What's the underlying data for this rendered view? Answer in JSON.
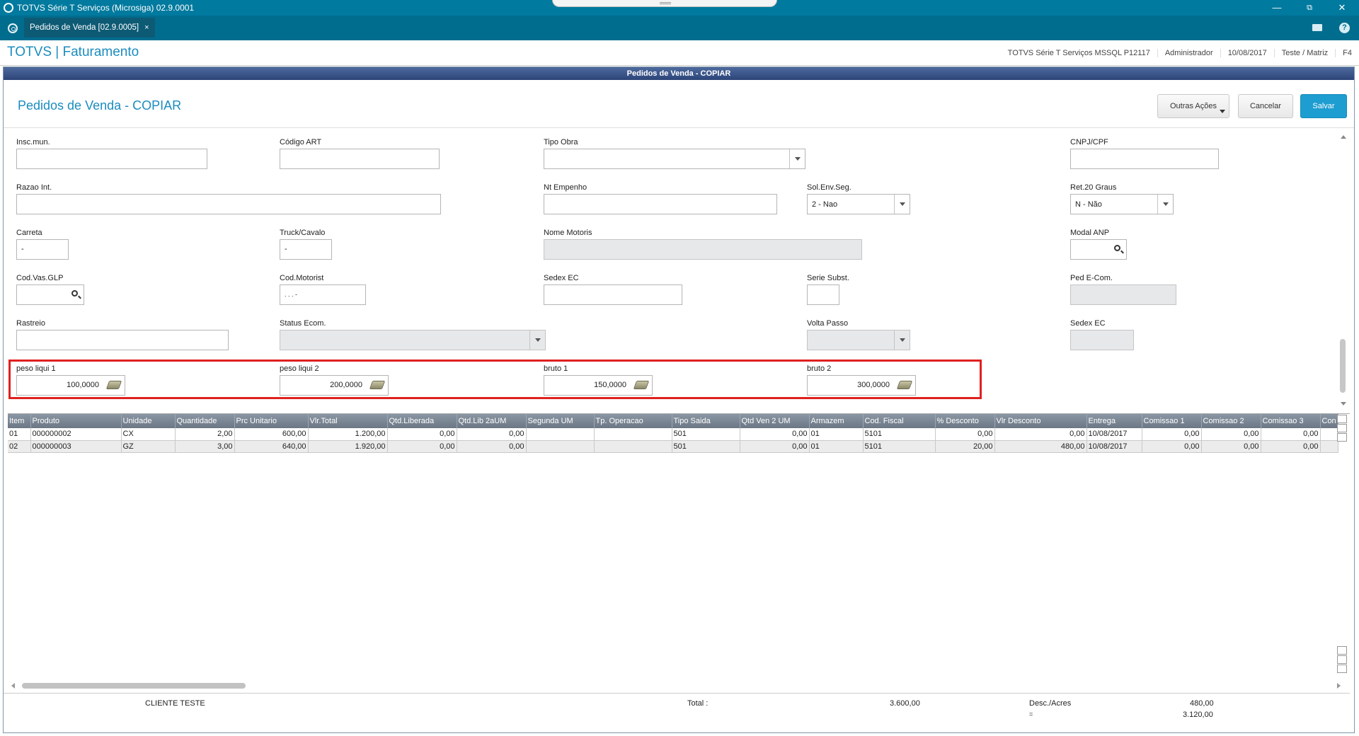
{
  "window": {
    "title": "TOTVS Série T Serviços (Microsiga) 02.9.0001"
  },
  "tab": {
    "label": "Pedidos de Venda [02.9.0005]",
    "close": "×"
  },
  "header": {
    "brand": "TOTVS | Faturamento",
    "env": "TOTVS Série T Serviços MSSQL P12117",
    "user": "Administrador",
    "date": "10/08/2017",
    "branch": "Teste / Matriz",
    "shortcut": "F4"
  },
  "frame": {
    "title": "Pedidos de Venda - COPIAR"
  },
  "page": {
    "title": "Pedidos de Venda - COPIAR",
    "btn_outras": "Outras Ações",
    "btn_cancelar": "Cancelar",
    "btn_salvar": "Salvar"
  },
  "fields": {
    "insc_mun": {
      "label": "Insc.mun.",
      "value": ""
    },
    "codigo_art": {
      "label": "Código ART",
      "value": ""
    },
    "tipo_obra": {
      "label": "Tipo Obra",
      "value": ""
    },
    "cnpj_cpf": {
      "label": "CNPJ/CPF",
      "value": ""
    },
    "razao_int": {
      "label": "Razao Int.",
      "value": ""
    },
    "nt_empenho": {
      "label": "Nt Empenho",
      "value": ""
    },
    "sol_env_seg": {
      "label": "Sol.Env.Seg.",
      "value": "2 - Nao"
    },
    "ret_20_graus": {
      "label": "Ret.20 Graus",
      "value": "N - Não"
    },
    "carreta": {
      "label": "Carreta",
      "value": "-"
    },
    "truck_cavalo": {
      "label": "Truck/Cavalo",
      "value": "-"
    },
    "nome_motoris": {
      "label": "Nome Motoris",
      "value": ""
    },
    "modal_anp": {
      "label": "Modal ANP",
      "value": ""
    },
    "cod_vas_glp": {
      "label": "Cod.Vas.GLP",
      "value": ""
    },
    "cod_motorist": {
      "label": "Cod.Motorist",
      "value": ". . . -"
    },
    "sedex_ec_1": {
      "label": "Sedex EC",
      "value": ""
    },
    "serie_subst": {
      "label": "Serie Subst.",
      "value": ""
    },
    "ped_ecom": {
      "label": "Ped E-Com.",
      "value": ""
    },
    "rastreio": {
      "label": "Rastreio",
      "value": ""
    },
    "status_ecom": {
      "label": "Status Ecom.",
      "value": ""
    },
    "volta_passo": {
      "label": "Volta Passo",
      "value": ""
    },
    "sedex_ec_2": {
      "label": "Sedex EC",
      "value": ""
    },
    "peso_liqui_1": {
      "label": "peso liqui 1",
      "value": "100,0000"
    },
    "peso_liqui_2": {
      "label": "peso liqui 2",
      "value": "200,0000"
    },
    "bruto_1": {
      "label": "bruto 1",
      "value": "150,0000"
    },
    "bruto_2": {
      "label": "bruto 2",
      "value": "300,0000"
    }
  },
  "grid": {
    "columns": [
      "Item",
      "Produto",
      "Unidade",
      "Quantidade",
      "Prc Unitario",
      "Vlr.Total",
      "Qtd.Liberada",
      "Qtd.Lib 2aUM",
      "Segunda UM",
      "Tp. Operacao",
      "Tipo Saida",
      "Qtd Ven 2 UM",
      "Armazem",
      "Cod. Fiscal",
      "% Desconto",
      "Vlr Desconto",
      "Entrega",
      "Comissao 1",
      "Comissao 2",
      "Comissao 3",
      "Con"
    ],
    "rows": [
      [
        "01",
        "000000002",
        "CX",
        "2,00",
        "600,00",
        "1.200,00",
        "0,00",
        "0,00",
        "",
        "",
        "501",
        "0,00",
        "01",
        "5101",
        "0,00",
        "0,00",
        "10/08/2017",
        "0,00",
        "0,00",
        "0,00",
        ""
      ],
      [
        "02",
        "000000003",
        "GZ",
        "3,00",
        "640,00",
        "1.920,00",
        "0,00",
        "0,00",
        "",
        "",
        "501",
        "0,00",
        "01",
        "5101",
        "20,00",
        "480,00",
        "10/08/2017",
        "0,00",
        "0,00",
        "0,00",
        ""
      ]
    ]
  },
  "footer": {
    "cliente": "CLIENTE TESTE",
    "total_label": "Total :",
    "total_value": "3.600,00",
    "desc_label": "Desc./Acres",
    "desc_value": "480,00",
    "eq_label": "=",
    "eq_value": "3.120,00"
  }
}
